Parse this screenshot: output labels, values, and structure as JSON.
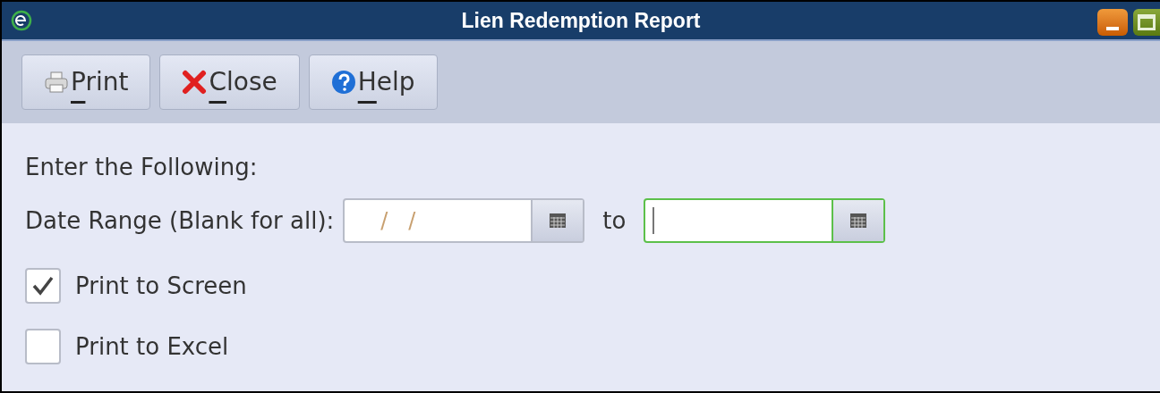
{
  "window": {
    "title": "Lien Redemption Report"
  },
  "toolbar": [
    {
      "label": "Print",
      "kind": "print"
    },
    {
      "label": "Close",
      "kind": "close"
    },
    {
      "label": "Help",
      "kind": "help"
    }
  ],
  "form": {
    "heading": "Enter the Following:",
    "date_range": {
      "label": "Date Range (Blank for all):",
      "from": {
        "value": "/   /",
        "focused": false
      },
      "separator": "to",
      "to": {
        "focused": true
      }
    },
    "options": [
      {
        "label": "Print to Screen",
        "checked": true
      },
      {
        "label": "Print to Excel",
        "checked": false
      }
    ]
  }
}
